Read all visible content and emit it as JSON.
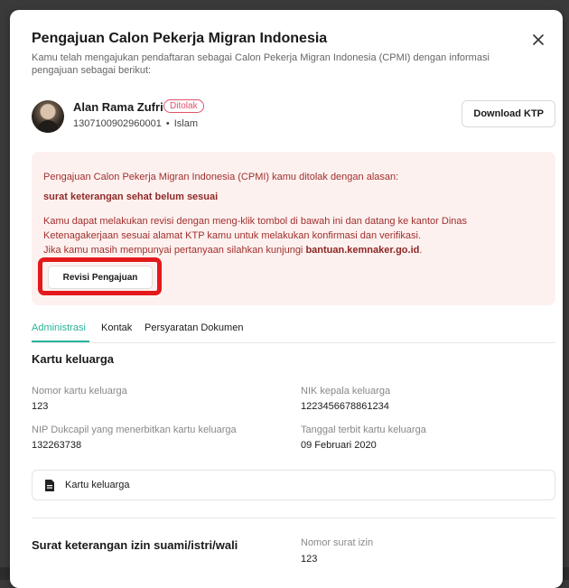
{
  "modal": {
    "title": "Pengajuan Calon Pekerja Migran Indonesia",
    "subtitle": "Kamu telah mengajukan pendaftaran sebagai Calon Pekerja Migran Indonesia (CPMI) dengan informasi pengajuan sebagai berikut:",
    "close_icon": "close-icon"
  },
  "user": {
    "name": "Alan Rama Zufri",
    "status": "Ditolak",
    "status_color": "#e0526b",
    "nik": "1307100902960001",
    "separator": "•",
    "religion": "Islam",
    "download_label": "Download KTP"
  },
  "alert": {
    "line1": "Pengajuan Calon Pekerja Migran Indonesia (CPMI) kamu ditolak dengan alasan:",
    "reason": "surat keterangan sehat belum sesuai",
    "body_line1": "Kamu dapat melakukan revisi dengan meng-klik tombol di bawah ini dan datang ke kantor Dinas",
    "body_line2": "Ketenagakerjaan sesuai alamat KTP kamu untuk melakukan konfirmasi dan verifikasi.",
    "body_line3_prefix": "Jika kamu masih mempunyai pertanyaan silahkan kunjungi ",
    "body_link": "bantuan.kemnaker.go.id",
    "body_line3_suffix": ".",
    "revise_label": "Revisi Pengajuan",
    "highlight_color": "#e3191c"
  },
  "tabs": [
    {
      "label": "Administrasi",
      "active": true
    },
    {
      "label": "Kontak",
      "active": false
    },
    {
      "label": "Persyaratan Dokumen",
      "active": false
    }
  ],
  "accent_color": "#2bb39a",
  "kk_section": {
    "title": "Kartu keluarga",
    "fields": [
      {
        "label": "Nomor kartu keluarga",
        "value": "123"
      },
      {
        "label": "NIK kepala keluarga",
        "value": "1223456678861234"
      },
      {
        "label": "NIP Dukcapil yang menerbitkan kartu keluarga",
        "value": "132263738"
      },
      {
        "label": "Tanggal terbit kartu keluarga",
        "value": "09 Februari 2020"
      }
    ],
    "document_label": "Kartu keluarga",
    "document_icon": "document-icon"
  },
  "izin_section": {
    "title": "Surat keterangan izin suami/istri/wali",
    "field_label": "Nomor surat izin",
    "field_value": "123"
  }
}
